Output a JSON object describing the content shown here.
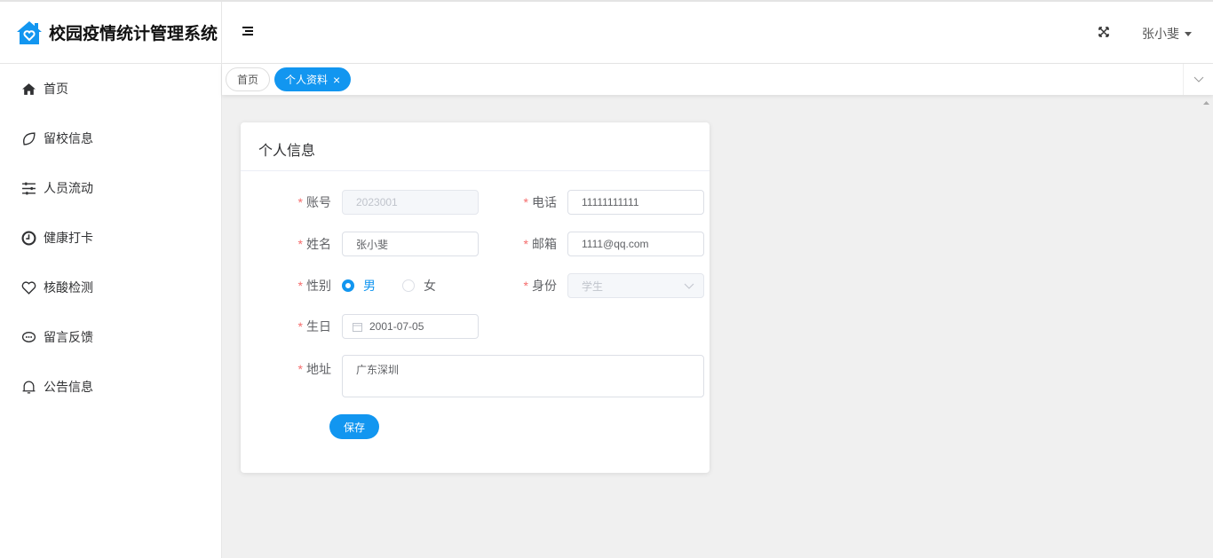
{
  "app": {
    "title": "校园疫情统计管理系统"
  },
  "sidebar": {
    "items": [
      {
        "label": "首页",
        "icon": "home-icon"
      },
      {
        "label": "留校信息",
        "icon": "leaf-icon"
      },
      {
        "label": "人员流动",
        "icon": "sliders-icon"
      },
      {
        "label": "健康打卡",
        "icon": "clock-icon"
      },
      {
        "label": "核酸检测",
        "icon": "heart-icon"
      },
      {
        "label": "留言反馈",
        "icon": "chat-icon"
      },
      {
        "label": "公告信息",
        "icon": "bell-icon"
      }
    ]
  },
  "header": {
    "user": "张小斐"
  },
  "tags": [
    {
      "label": "首页"
    },
    {
      "label": "个人资料",
      "close": "×"
    }
  ],
  "card": {
    "title": "个人信息",
    "fields": {
      "account": {
        "label": "账号",
        "value": "2023001"
      },
      "phone": {
        "label": "电话",
        "value": "11111111111"
      },
      "name": {
        "label": "姓名",
        "value": "张小斐"
      },
      "email": {
        "label": "邮箱",
        "value": "1111@qq.com"
      },
      "gender": {
        "label": "性别",
        "options": [
          "男",
          "女"
        ],
        "selected": "男"
      },
      "role": {
        "label": "身份",
        "value": "学生"
      },
      "birthday": {
        "label": "生日",
        "value": "2001-07-05"
      },
      "address": {
        "label": "地址",
        "value": "广东深圳"
      }
    },
    "save": "保存"
  },
  "colors": {
    "primary": "#1296f0",
    "required": "#f56c6c"
  }
}
